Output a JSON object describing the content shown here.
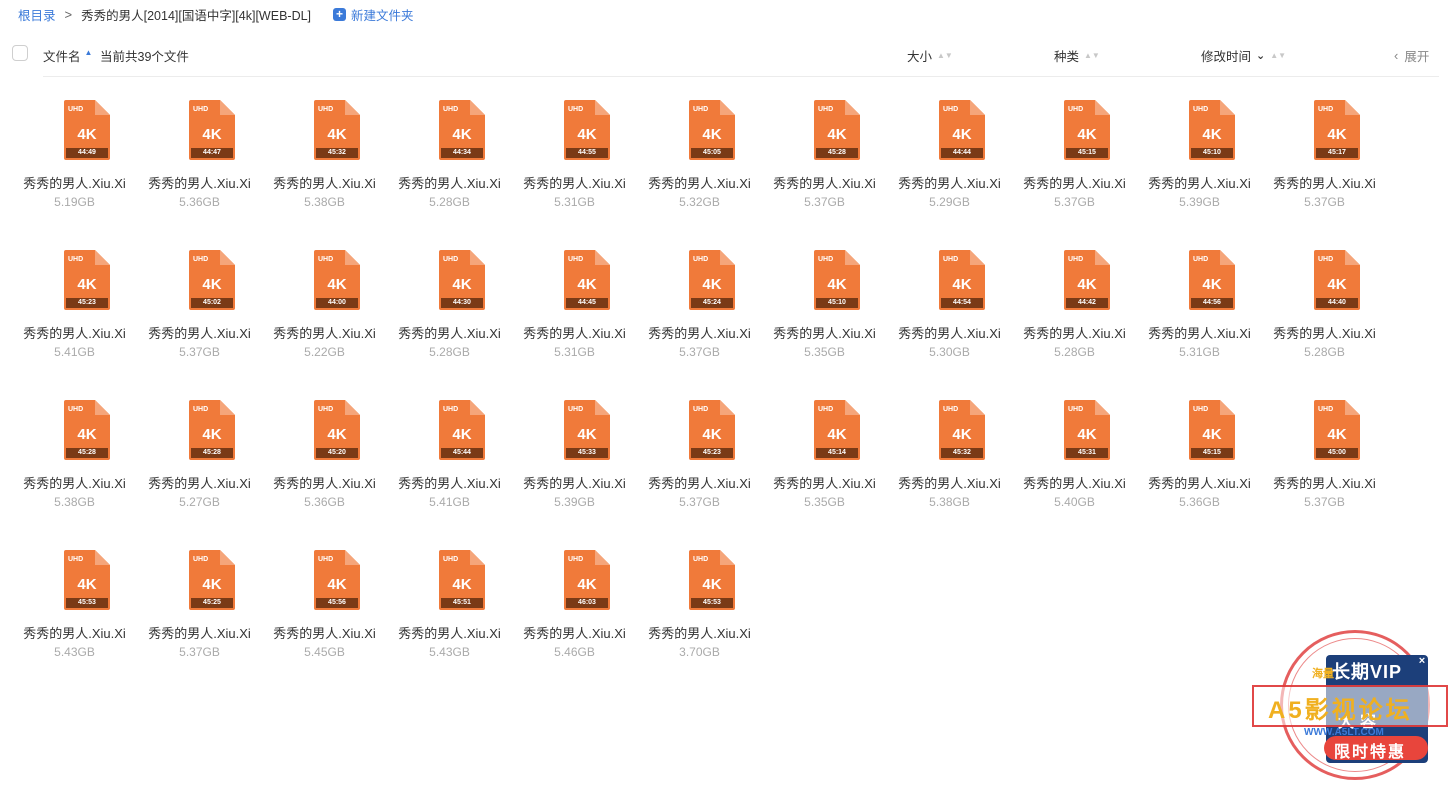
{
  "breadcrumb": {
    "root": "根目录",
    "separator": ">",
    "current": "秀秀的男人[2014][国语中字][4k][WEB-DL]",
    "new_folder": "新建文件夹",
    "new_folder_icon": "plus-square-icon"
  },
  "list_header": {
    "name": "文件名",
    "count": "当前共39个文件",
    "size": "大小",
    "type": "种类",
    "mtime": "修改时间",
    "expand": "展开"
  },
  "file_icon": {
    "badge": "UHD",
    "label": "4K",
    "color": "#f07a3a"
  },
  "files": [
    {
      "name": "秀秀的男人.Xiu.Xi",
      "duration": "44:49",
      "size": "5.19GB"
    },
    {
      "name": "秀秀的男人.Xiu.Xi",
      "duration": "44:47",
      "size": "5.36GB"
    },
    {
      "name": "秀秀的男人.Xiu.Xi",
      "duration": "45:32",
      "size": "5.38GB"
    },
    {
      "name": "秀秀的男人.Xiu.Xi",
      "duration": "44:34",
      "size": "5.28GB"
    },
    {
      "name": "秀秀的男人.Xiu.Xi",
      "duration": "44:55",
      "size": "5.31GB"
    },
    {
      "name": "秀秀的男人.Xiu.Xi",
      "duration": "45:05",
      "size": "5.32GB"
    },
    {
      "name": "秀秀的男人.Xiu.Xi",
      "duration": "45:28",
      "size": "5.37GB"
    },
    {
      "name": "秀秀的男人.Xiu.Xi",
      "duration": "44:44",
      "size": "5.29GB"
    },
    {
      "name": "秀秀的男人.Xiu.Xi",
      "duration": "45:15",
      "size": "5.37GB"
    },
    {
      "name": "秀秀的男人.Xiu.Xi",
      "duration": "45:10",
      "size": "5.39GB"
    },
    {
      "name": "秀秀的男人.Xiu.Xi",
      "duration": "45:17",
      "size": "5.37GB"
    },
    {
      "name": "秀秀的男人.Xiu.Xi",
      "duration": "45:23",
      "size": "5.41GB"
    },
    {
      "name": "秀秀的男人.Xiu.Xi",
      "duration": "45:02",
      "size": "5.37GB"
    },
    {
      "name": "秀秀的男人.Xiu.Xi",
      "duration": "44:00",
      "size": "5.22GB"
    },
    {
      "name": "秀秀的男人.Xiu.Xi",
      "duration": "44:30",
      "size": "5.28GB"
    },
    {
      "name": "秀秀的男人.Xiu.Xi",
      "duration": "44:45",
      "size": "5.31GB"
    },
    {
      "name": "秀秀的男人.Xiu.Xi",
      "duration": "45:24",
      "size": "5.37GB"
    },
    {
      "name": "秀秀的男人.Xiu.Xi",
      "duration": "45:10",
      "size": "5.35GB"
    },
    {
      "name": "秀秀的男人.Xiu.Xi",
      "duration": "44:54",
      "size": "5.30GB"
    },
    {
      "name": "秀秀的男人.Xiu.Xi",
      "duration": "44:42",
      "size": "5.28GB"
    },
    {
      "name": "秀秀的男人.Xiu.Xi",
      "duration": "44:56",
      "size": "5.31GB"
    },
    {
      "name": "秀秀的男人.Xiu.Xi",
      "duration": "44:40",
      "size": "5.28GB"
    },
    {
      "name": "秀秀的男人.Xiu.Xi",
      "duration": "45:28",
      "size": "5.38GB"
    },
    {
      "name": "秀秀的男人.Xiu.Xi",
      "duration": "45:28",
      "size": "5.27GB"
    },
    {
      "name": "秀秀的男人.Xiu.Xi",
      "duration": "45:20",
      "size": "5.36GB"
    },
    {
      "name": "秀秀的男人.Xiu.Xi",
      "duration": "45:44",
      "size": "5.41GB"
    },
    {
      "name": "秀秀的男人.Xiu.Xi",
      "duration": "45:33",
      "size": "5.39GB"
    },
    {
      "name": "秀秀的男人.Xiu.Xi",
      "duration": "45:23",
      "size": "5.37GB"
    },
    {
      "name": "秀秀的男人.Xiu.Xi",
      "duration": "45:14",
      "size": "5.35GB"
    },
    {
      "name": "秀秀的男人.Xiu.Xi",
      "duration": "45:32",
      "size": "5.38GB"
    },
    {
      "name": "秀秀的男人.Xiu.Xi",
      "duration": "45:31",
      "size": "5.40GB"
    },
    {
      "name": "秀秀的男人.Xiu.Xi",
      "duration": "45:15",
      "size": "5.36GB"
    },
    {
      "name": "秀秀的男人.Xiu.Xi",
      "duration": "45:00",
      "size": "5.37GB"
    },
    {
      "name": "秀秀的男人.Xiu.Xi",
      "duration": "45:53",
      "size": "5.43GB"
    },
    {
      "name": "秀秀的男人.Xiu.Xi",
      "duration": "45:25",
      "size": "5.37GB"
    },
    {
      "name": "秀秀的男人.Xiu.Xi",
      "duration": "45:56",
      "size": "5.45GB"
    },
    {
      "name": "秀秀的男人.Xiu.Xi",
      "duration": "45:51",
      "size": "5.43GB"
    },
    {
      "name": "秀秀的男人.Xiu.Xi",
      "duration": "46:03",
      "size": "5.46GB"
    },
    {
      "name": "秀秀的男人.Xiu.Xi",
      "duration": "45:53",
      "size": "3.70GB"
    }
  ],
  "promo": {
    "card_top": "长期VIP",
    "small_left": "海量",
    "banner": "A5影视论坛",
    "card_mid": "大容",
    "url": "WWW.A5LT.COM",
    "button": "限时特惠",
    "close": "×"
  }
}
